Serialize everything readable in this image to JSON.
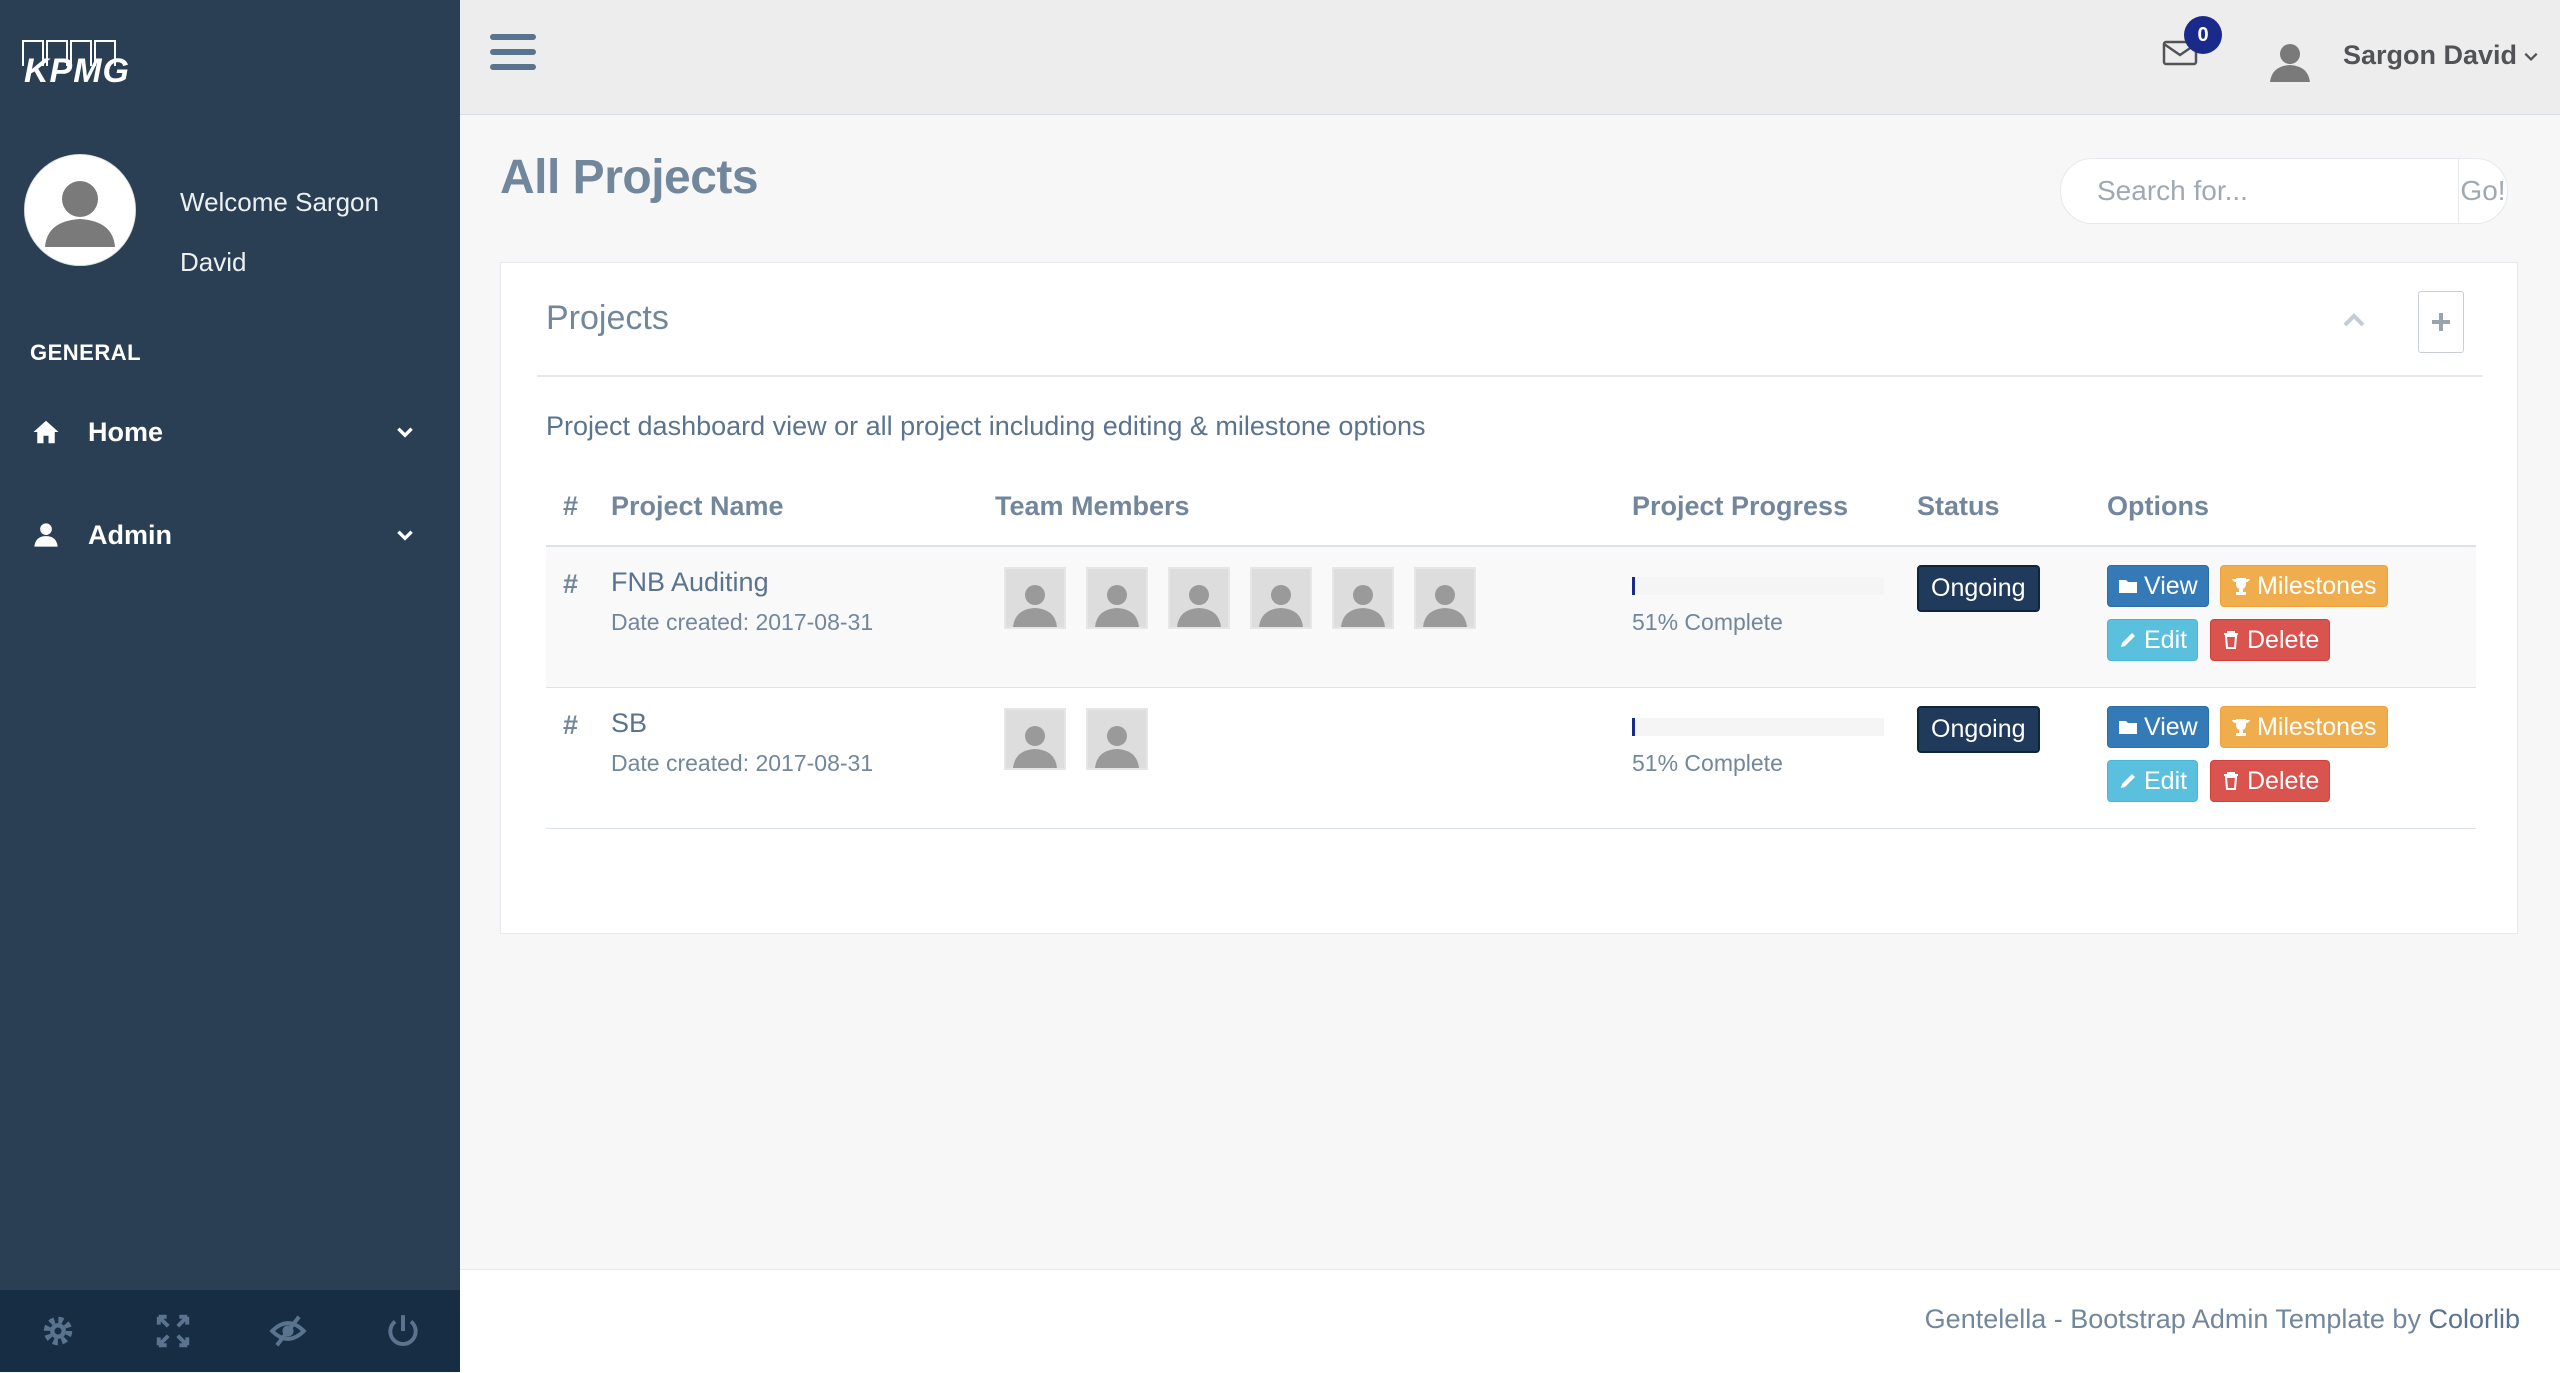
{
  "brand": {
    "logo_text": "KPMG"
  },
  "sidebar": {
    "welcome": "Welcome Sargon David",
    "section_title": "GENERAL",
    "items": [
      {
        "label": "Home",
        "icon": "home-icon"
      },
      {
        "label": "Admin",
        "icon": "user-icon"
      }
    ],
    "footer_icons": [
      "gear-icon",
      "fullscreen-icon",
      "eye-slash-icon",
      "power-icon"
    ]
  },
  "topnav": {
    "mail_count": "0",
    "user_name": "Sargon David"
  },
  "page": {
    "title": "All Projects",
    "search_placeholder": "Search for...",
    "search_button": "Go!"
  },
  "panel": {
    "title": "Projects",
    "description": "Project dashboard view or all project including editing & milestone options",
    "columns": [
      "#",
      "Project Name",
      "Team Members",
      "Project Progress",
      "Status",
      "Options"
    ],
    "rows": [
      {
        "hash": "#",
        "name": "FNB Auditing",
        "date": "Date created: 2017-08-31",
        "member_count": 6,
        "progress": 0.01,
        "progress_text": "51% Complete",
        "status": "Ongoing"
      },
      {
        "hash": "#",
        "name": "SB",
        "date": "Date created: 2017-08-31",
        "member_count": 2,
        "progress": 0.01,
        "progress_text": "51% Complete",
        "status": "Ongoing"
      }
    ],
    "buttons": {
      "view": "View",
      "milestones": "Milestones",
      "edit": "Edit",
      "delete": "Delete"
    }
  },
  "footer": {
    "text": "Gentelella - Bootstrap Admin Template by ",
    "link": "Colorlib"
  },
  "colors": {
    "sidebar_bg": "#2a3f54",
    "accent_navy": "#1a2a8a",
    "view": "#337ab7",
    "milestones": "#f0ad4e",
    "edit": "#5bc0de",
    "delete": "#d9534f"
  }
}
